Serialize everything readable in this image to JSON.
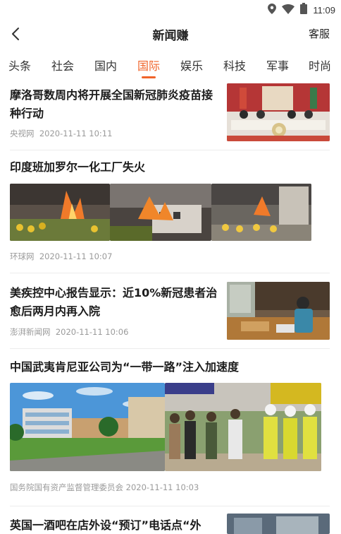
{
  "status_bar": {
    "time": "11:09",
    "icons": [
      "location-icon",
      "wifi-icon",
      "battery-icon"
    ]
  },
  "nav": {
    "back_icon": "chevron-left-icon",
    "title": "新闻赚",
    "service_label": "客服"
  },
  "tabs": [
    {
      "label": "头条",
      "active": false
    },
    {
      "label": "社会",
      "active": false
    },
    {
      "label": "国内",
      "active": false
    },
    {
      "label": "国际",
      "active": true
    },
    {
      "label": "娱乐",
      "active": false
    },
    {
      "label": "科技",
      "active": false
    },
    {
      "label": "军事",
      "active": false
    },
    {
      "label": "时尚",
      "active": false
    }
  ],
  "articles": [
    {
      "title_line1": "摩洛哥数周内将开展全国新冠肺炎疫苗接",
      "title_line2": "种行动",
      "source": "央视网",
      "date": "2020-11-11 10:11"
    },
    {
      "title_line1": "印度班加罗尔一化工厂失火",
      "source": "环球网",
      "date": "2020-11-11 10:07"
    },
    {
      "title_line1": "美疾控中心报告显示：近10%新冠患者治",
      "title_line2": "愈后两月内再入院",
      "source": "澎湃新闻网",
      "date": "2020-11-11 10:06"
    },
    {
      "title_line1": "中国武夷肯尼亚公司为“一带一路”注入加速度",
      "source": "国务院国有资产监督管理委员会",
      "date": "2020-11-11 10:03"
    },
    {
      "title_line1": "英国一酒吧在店外设“预订”电话点“外"
    }
  ],
  "colors": {
    "accent": "#f0642a",
    "text": "#1c1c1c",
    "meta": "#9a9a9a"
  }
}
